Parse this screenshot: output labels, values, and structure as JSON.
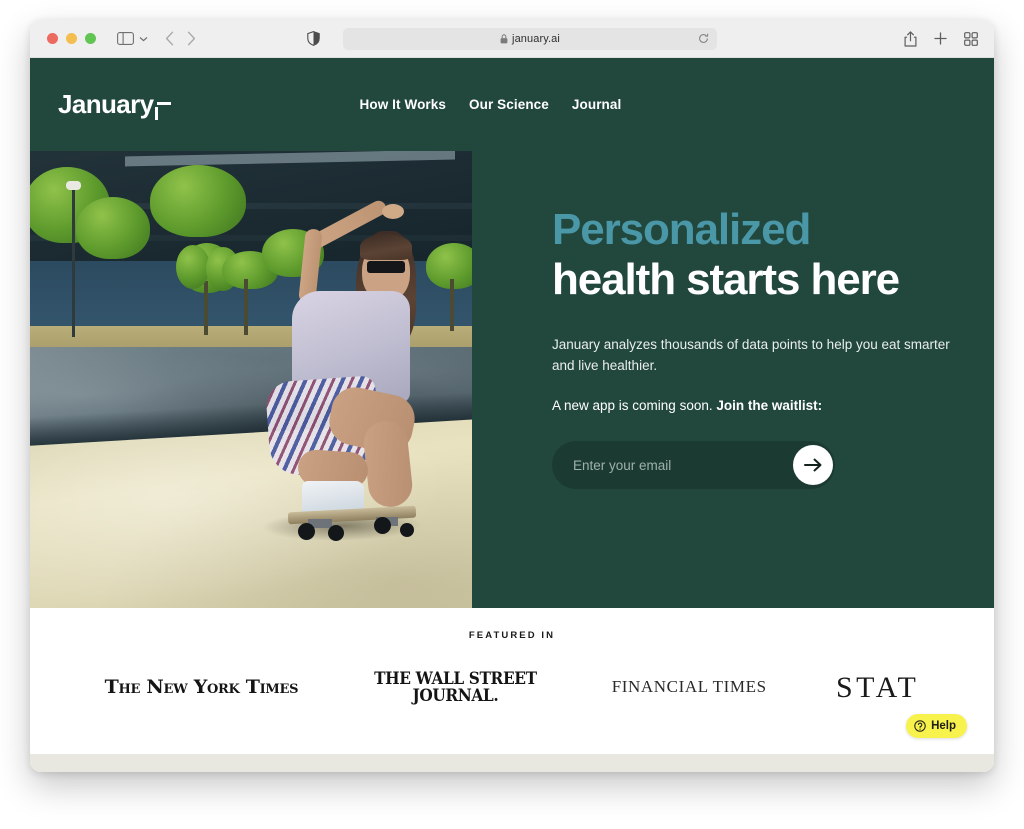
{
  "browser": {
    "traffic_lights": [
      "close",
      "minimize",
      "maximize"
    ],
    "sidebar_toggle_label": "Sidebar",
    "back_label": "Back",
    "forward_label": "Forward",
    "shield_label": "Privacy Report",
    "url": "january.ai",
    "reload_label": "Reload",
    "share_label": "Share",
    "new_tab_label": "New Tab",
    "tab_overview_label": "Tab Overview"
  },
  "site": {
    "logo_text": "January",
    "nav": [
      {
        "label": "How It Works"
      },
      {
        "label": "Our Science"
      },
      {
        "label": "Journal"
      }
    ],
    "colors": {
      "brand_green": "#22473d",
      "accent_teal": "#4a97a8",
      "input_green": "#1b3b32",
      "help_yellow": "#f7f24c"
    }
  },
  "hero": {
    "headline_accent": "Personalized",
    "headline_plain": "health starts here",
    "paragraph": "January analyzes thousands of data points to help you eat smarter and live healthier.",
    "sub_regular": "A new app is coming soon.",
    "sub_bold": "Join the waitlist:",
    "email_placeholder": "Enter your email",
    "email_value": "",
    "submit_label": "Submit"
  },
  "featured": {
    "label": "FEATURED IN",
    "publications": [
      {
        "name": "The New York Times",
        "style": "nyt"
      },
      {
        "name": "THE WALL STREET JOURNAL",
        "line1": "THE WALL STREET",
        "line2": "JOURNAL.",
        "style": "wsj"
      },
      {
        "name": "FINANCIAL TIMES",
        "style": "ft"
      },
      {
        "name": "STAT",
        "style": "stat"
      }
    ]
  },
  "help": {
    "label": "Help"
  }
}
